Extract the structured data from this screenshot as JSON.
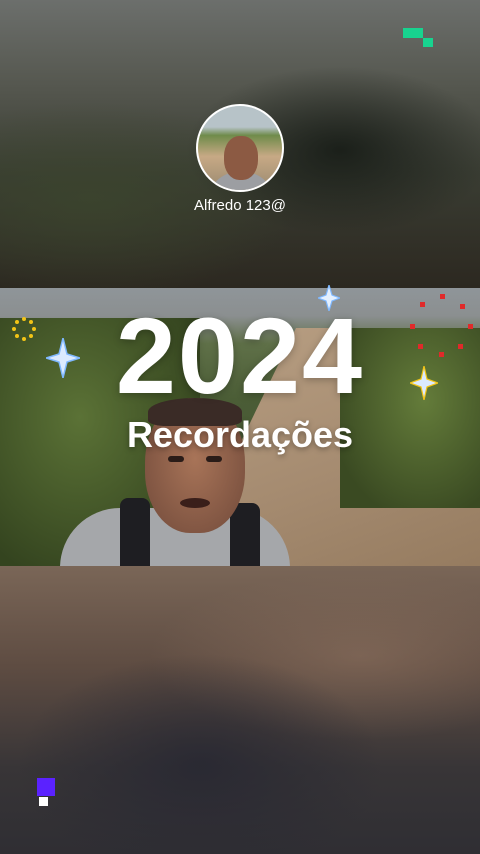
{
  "story": {
    "username": "Alfredo 123@",
    "year": "2024",
    "subtitle": "Recordações"
  },
  "icons": {
    "top_right_logo": "brand-logo-icon",
    "bottom_left_logo": "brand-logo-icon",
    "sparkles": [
      "sparkle-icon",
      "sparkle-icon",
      "sparkle-icon"
    ],
    "firework": "firework-icon",
    "sun_burst": "sunburst-icon"
  },
  "colors": {
    "logo_green": "#18d38f",
    "logo_purple": "#5b22ff",
    "firework_red": "#e02a2a",
    "sunburst_yellow": "#f2c416",
    "sparkle_blue": "#7fb8ff"
  }
}
